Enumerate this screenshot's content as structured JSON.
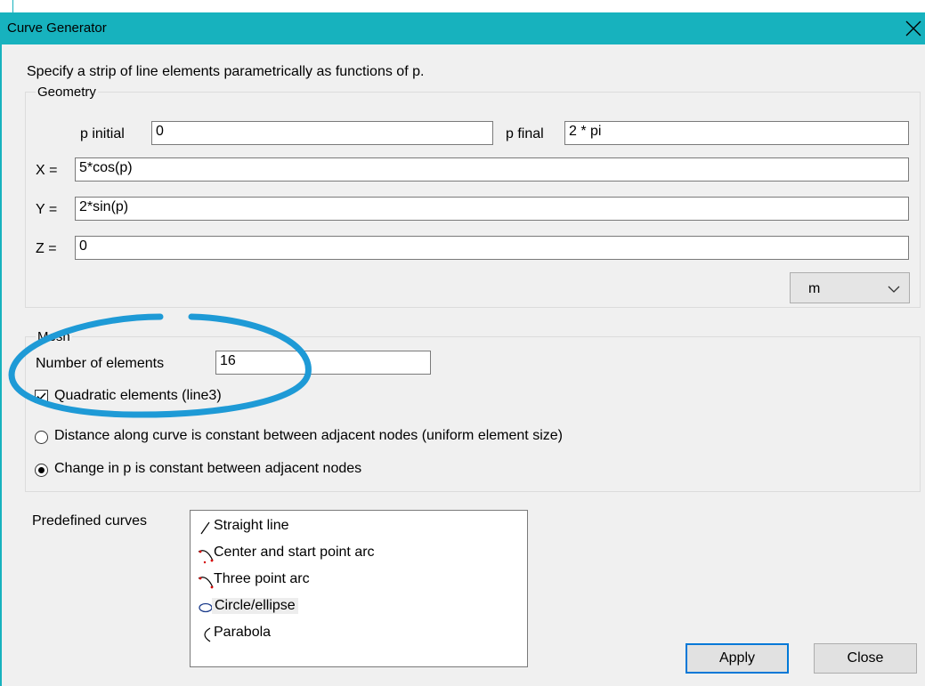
{
  "window": {
    "title": "Curve Generator"
  },
  "description": "Specify a strip of line elements parametrically as functions of p.",
  "geometry": {
    "group_label": "Geometry",
    "p_initial_label": "p initial",
    "p_initial_value": "0",
    "p_final_label": "p final",
    "p_final_value": "2 * pi",
    "x_label": "X =",
    "x_value": "5*cos(p)",
    "y_label": "Y =",
    "y_value": "2*sin(p)",
    "z_label": "Z =",
    "z_value": "0",
    "units_value": "m"
  },
  "mesh": {
    "group_label": "Mesh",
    "num_elements_label": "Number of elements",
    "num_elements_value": "16",
    "quadratic_label": "Quadratic elements (line3)",
    "quadratic_checked": true,
    "radio_distance_label": "Distance along curve is constant between adjacent nodes (uniform element size)",
    "radio_p_label": "Change in p is constant between adjacent nodes",
    "selected_radio": "change-in-p"
  },
  "predefined": {
    "label": "Predefined curves",
    "items": [
      {
        "label": "Straight line",
        "icon": "straight-line-icon"
      },
      {
        "label": "Center and start point arc",
        "icon": "arc-icon"
      },
      {
        "label": "Three point arc",
        "icon": "arc-icon"
      },
      {
        "label": "Circle/ellipse",
        "icon": "ellipse-icon"
      },
      {
        "label": "Parabola",
        "icon": "parabola-icon"
      }
    ],
    "selected_index": 3
  },
  "buttons": {
    "apply": "Apply",
    "close": "Close"
  },
  "colors": {
    "titlebar": "#17b2be",
    "annotation": "#1e9ad6",
    "default_button_border": "#0078d7"
  }
}
